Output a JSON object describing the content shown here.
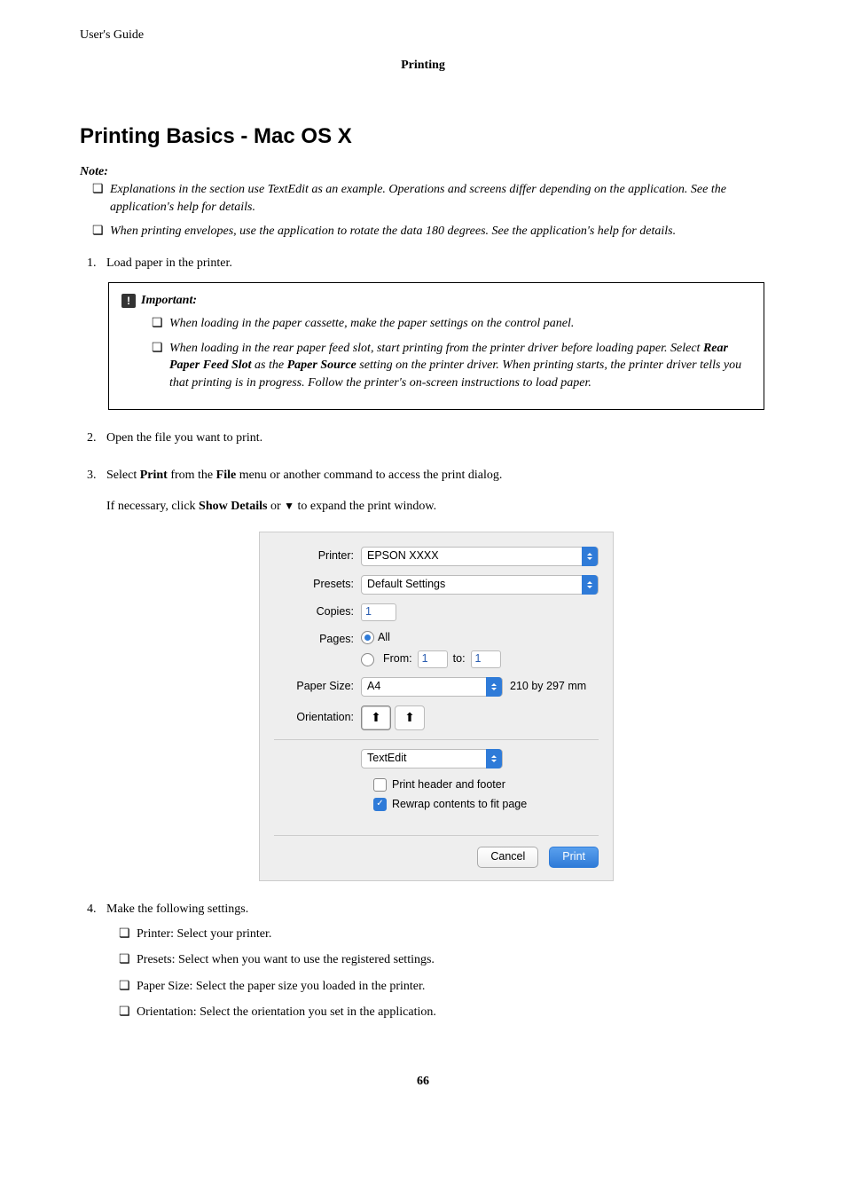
{
  "header": {
    "guide": "User's Guide",
    "section": "Printing"
  },
  "title": "Printing Basics - Mac OS X",
  "note": {
    "label": "Note:",
    "items": [
      "Explanations in the section use TextEdit as an example. Operations and screens differ depending on the application. See the application's help for details.",
      "When printing envelopes, use the application to rotate the data 180 degrees. See the application's help for details."
    ]
  },
  "steps": {
    "s1": "Load paper in the printer.",
    "important": {
      "label": "Important:",
      "i1": "When loading in the paper cassette, make the paper settings on the control panel.",
      "i2": {
        "pre": "When loading in the rear paper feed slot, start printing from the printer driver before loading paper. Select ",
        "b1": "Rear Paper Feed Slot",
        "mid1": " as the ",
        "b2": "Paper Source",
        "post": " setting on the printer driver. When printing starts, the printer driver tells you that printing is in progress. Follow the printer's on-screen instructions to load paper."
      }
    },
    "s2": "Open the file you want to print.",
    "s3": {
      "pre": "Select ",
      "b1": "Print",
      "mid1": " from the ",
      "b2": "File",
      "post": " menu or another command to access the print dialog.",
      "sub_pre": "If necessary, click ",
      "sub_b": "Show Details",
      "sub_mid": " or ",
      "sub_post": " to expand the print window."
    },
    "s4": "Make the following settings.",
    "s4_items": [
      "Printer: Select your printer.",
      "Presets: Select when you want to use the registered settings.",
      "Paper Size: Select the paper size you loaded in the printer.",
      "Orientation: Select the orientation you set in the application."
    ]
  },
  "dialog": {
    "printer_label": "Printer:",
    "printer_value": "EPSON XXXX",
    "presets_label": "Presets:",
    "presets_value": "Default Settings",
    "copies_label": "Copies:",
    "copies_value": "1",
    "pages_label": "Pages:",
    "pages_all": "All",
    "pages_from_label": "From:",
    "pages_from_value": "1",
    "pages_to_label": "to:",
    "pages_to_value": "1",
    "papersize_label": "Paper Size:",
    "papersize_value": "A4",
    "papersize_dim": "210 by 297 mm",
    "orientation_label": "Orientation:",
    "panel_value": "TextEdit",
    "chk_header": "Print header and footer",
    "chk_rewrap": "Rewrap contents to fit page",
    "cancel": "Cancel",
    "print": "Print"
  },
  "page_number": "66"
}
